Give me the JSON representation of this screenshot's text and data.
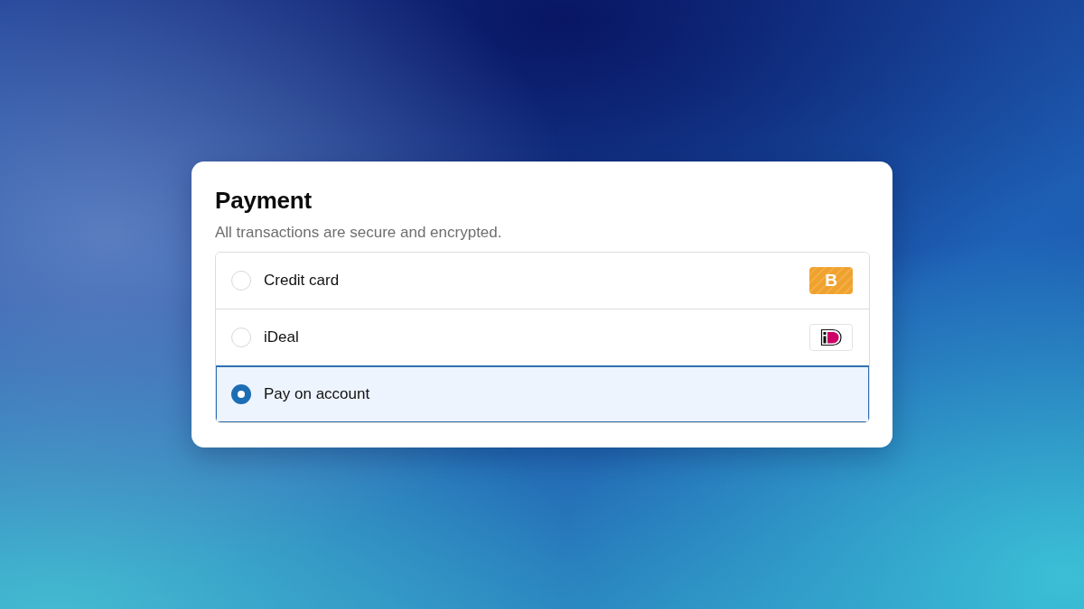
{
  "title": "Payment",
  "subtitle": "All transactions are secure and encrypted.",
  "options": [
    {
      "label": "Credit card",
      "selected": false,
      "badge": {
        "kind": "letter",
        "text": "B"
      }
    },
    {
      "label": "iDeal",
      "selected": false,
      "badge": {
        "kind": "logo"
      }
    },
    {
      "label": "Pay on account",
      "selected": true
    }
  ]
}
